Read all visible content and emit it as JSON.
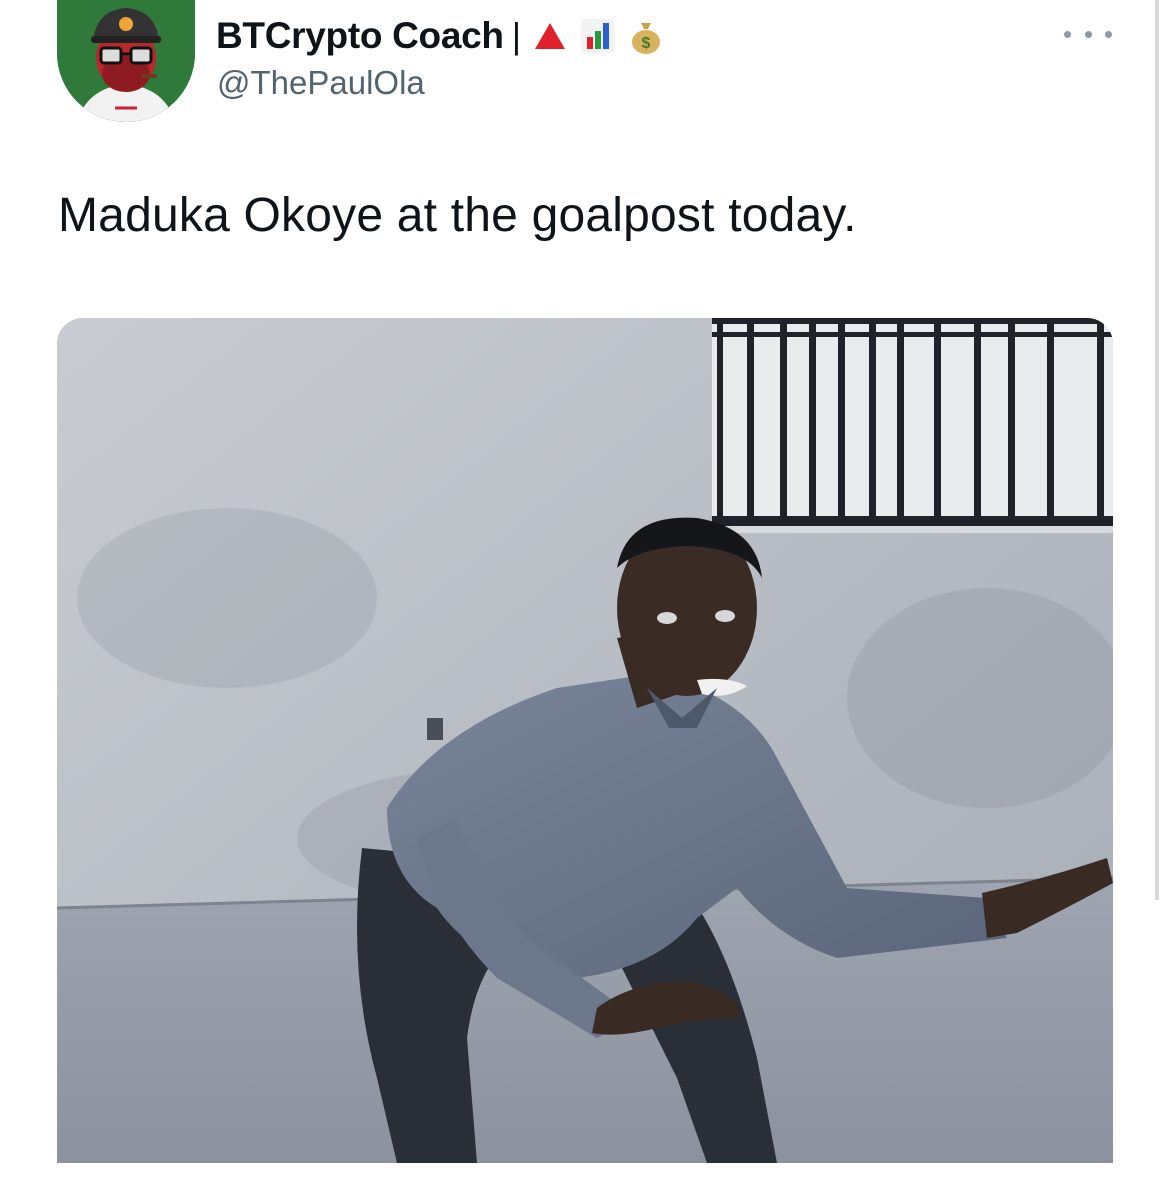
{
  "author": {
    "display_name": "BTCrypto Coach",
    "separator": "|",
    "handle": "@ThePaulOla",
    "name_emojis": [
      "red-triangle-icon",
      "bar-chart-icon",
      "money-bag-icon"
    ],
    "avatar_icon": "avatar-icon"
  },
  "more_button": {
    "icon": "more-horizontal-icon"
  },
  "tweet": {
    "text": "Maduka Okoye at the goalpost today."
  },
  "media": {
    "kind": "photo",
    "style": "monochrome blue-gray"
  },
  "colors": {
    "text": "#0f1419",
    "secondary_text": "#536471",
    "avatar_bg": "#2f7a3a",
    "triangle": "#e0202a"
  }
}
